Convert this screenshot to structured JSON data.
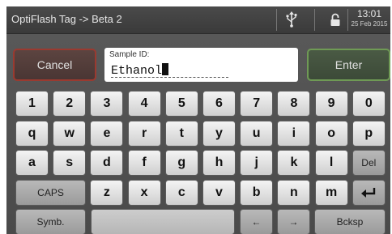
{
  "header": {
    "title": "OptiFlash Tag -> Beta 2",
    "time": "13:01",
    "date": "25 Feb 2015",
    "icons": [
      "usb-icon",
      "lock-icon"
    ]
  },
  "controls": {
    "cancel_label": "Cancel",
    "enter_label": "Enter"
  },
  "sample": {
    "label": "Sample ID:",
    "value": "Ethanol"
  },
  "keys": {
    "numbers": [
      "1",
      "2",
      "3",
      "4",
      "5",
      "6",
      "7",
      "8",
      "9",
      "0"
    ],
    "row_q": [
      "q",
      "w",
      "e",
      "r",
      "t",
      "y",
      "u",
      "i",
      "o",
      "p"
    ],
    "row_a": [
      "a",
      "s",
      "d",
      "f",
      "g",
      "h",
      "j",
      "k",
      "l"
    ],
    "del": "Del",
    "caps": "CAPS",
    "row_z": [
      "z",
      "x",
      "c",
      "v",
      "b",
      "n",
      "m"
    ],
    "return_icon": "return-arrow-icon",
    "symb": "Symb.",
    "left_arrow": "←",
    "right_arrow": "→",
    "backspace": "Bcksp"
  }
}
